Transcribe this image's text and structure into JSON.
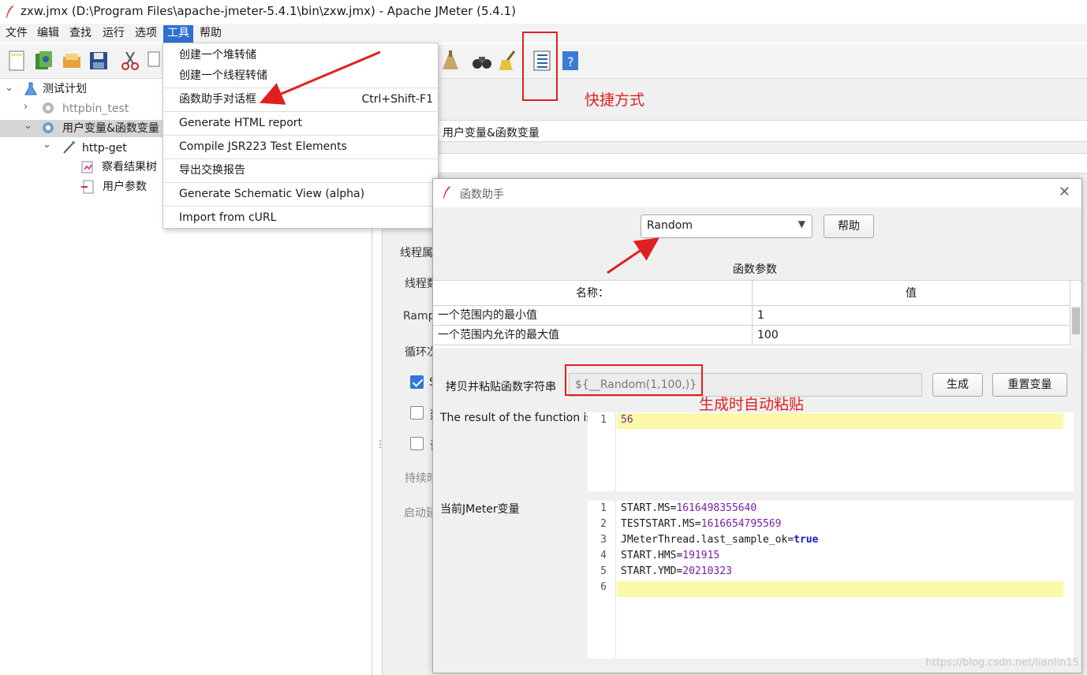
{
  "window": {
    "title": "zxw.jmx (D:\\Program Files\\apache-jmeter-5.4.1\\bin\\zxw.jmx) - Apache JMeter (5.4.1)"
  },
  "menubar": {
    "items": [
      "文件",
      "编辑",
      "查找",
      "运行",
      "选项",
      "工具",
      "帮助"
    ],
    "active": "工具"
  },
  "tools_menu": {
    "items": [
      {
        "label": "创建一个堆转储",
        "shortcut": ""
      },
      {
        "label": "创建一个线程转储",
        "shortcut": ""
      },
      {
        "label": "函数助手对话框",
        "shortcut": "Ctrl+Shift-F1"
      },
      {
        "label": "Generate HTML report",
        "shortcut": ""
      },
      {
        "label": "Compile JSR223 Test Elements",
        "shortcut": ""
      },
      {
        "label": "导出交换报告",
        "shortcut": ""
      },
      {
        "label": "Generate Schematic View (alpha)",
        "shortcut": ""
      },
      {
        "label": "Import from cURL",
        "shortcut": ""
      }
    ]
  },
  "tree": {
    "nodes": [
      {
        "label": "测试计划",
        "icon": "test-plan-icon"
      },
      {
        "label": "httpbin_test",
        "icon": "gear-icon",
        "disabled": true
      },
      {
        "label": "用户变量&函数变量",
        "icon": "gear-icon",
        "selected": true
      },
      {
        "label": "http-get",
        "icon": "sampler-pipette-icon"
      },
      {
        "label": "察看结果树",
        "icon": "results-tree-icon"
      },
      {
        "label": "用户参数",
        "icon": "user-params-icon"
      }
    ]
  },
  "right_panel": {
    "name_value": "用户变量&函数变量",
    "thread_props_label": "线程属",
    "threads_label": "线程数",
    "ramp_label": "Ramp",
    "loop_label": "循环次",
    "checkbox1_label": "S",
    "checkbox2_label": "延",
    "checkbox3_label": "调",
    "duration_label": "持续时",
    "startup_label": "启动延"
  },
  "dialog": {
    "title": "函数助手",
    "selected_function": "Random",
    "help_button": "帮助",
    "params_title": "函数参数",
    "table": {
      "headers": [
        "名称：",
        "值"
      ],
      "rows": [
        [
          "一个范围内的最小值",
          "1"
        ],
        [
          "一个范围内允许的最大值",
          "100"
        ]
      ]
    },
    "copy_label": "拷贝并粘贴函数字符串",
    "function_string": "${__Random(1,100,)}",
    "generate_button": "生成",
    "reset_button": "重置变量",
    "result_label": "The result of the function is",
    "result_lines": [
      "56"
    ],
    "vars_label": "当前JMeter变量",
    "vars_lines": [
      {
        "ln": "1",
        "key": "START.MS=",
        "val": "1616498355640",
        "kw": false
      },
      {
        "ln": "2",
        "key": "TESTSTART.MS=",
        "val": "1616654795569",
        "kw": false
      },
      {
        "ln": "3",
        "key": "JMeterThread.last_sample_ok=",
        "val": "true",
        "kw": true
      },
      {
        "ln": "4",
        "key": "START.HMS=",
        "val": "191915",
        "kw": false
      },
      {
        "ln": "5",
        "key": "START.YMD=",
        "val": "20210323",
        "kw": false
      },
      {
        "ln": "6",
        "key": "",
        "val": "",
        "kw": false
      }
    ]
  },
  "annotations": {
    "shortcut_note": "快捷方式",
    "autopaste_note": "生成时自动粘贴"
  },
  "watermark": "https://blog.csdn.net/lianlin15",
  "colors": {
    "menu_active": "#2e6fd0",
    "annotation": "#e02020",
    "highlight_line": "#fbf9a8"
  }
}
